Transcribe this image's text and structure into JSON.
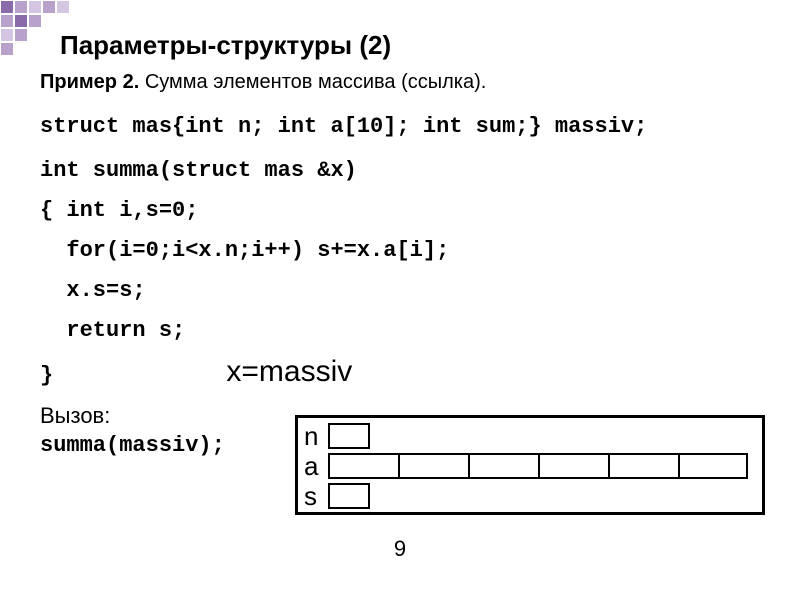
{
  "title": "Параметры-структуры (2)",
  "example_prefix": "Пример 2.",
  "example_text": "Сумма элементов массива (ссылка).",
  "code_lines": {
    "l1": "struct mas{int n; int a[10]; int sum;} massiv;",
    "l2": "int summa(struct mas &x)",
    "l3": "{ int i,s=0;",
    "l4": "  for(i=0;i<x.n;i++) s+=x.a[i];",
    "l5": "  x.s=s;",
    "l6": "  return s;",
    "l7": "}"
  },
  "xvar": "x=massiv",
  "call_label": "Вызов:",
  "call_code": "summa(massiv);",
  "diagram": {
    "row1": "n",
    "row2": "a",
    "row3": "s"
  },
  "page_number": "9"
}
